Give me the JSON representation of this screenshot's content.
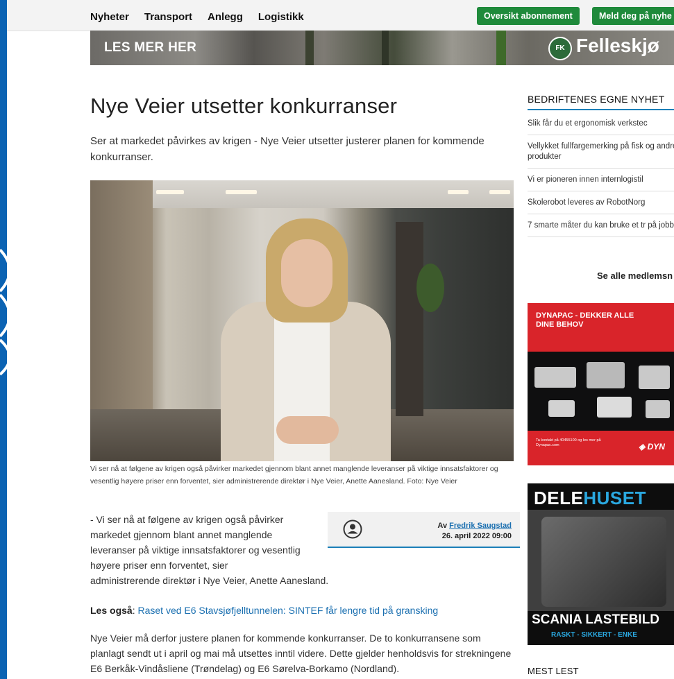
{
  "nav": {
    "items": [
      "Nyheter",
      "Transport",
      "Anlegg",
      "Logistikk"
    ],
    "subscription_button": "Oversikt abonnement",
    "newsletter_button": "Meld deg på nyhe"
  },
  "banner": {
    "text": "LES MER HER",
    "logo": "FK",
    "brand": "Felleskjø"
  },
  "article": {
    "title": "Nye Veier utsetter konkurranser",
    "lead": "Ser at markedet påvirkes av krigen - Nye Veier utsetter justerer planen for kommende konkurranser.",
    "caption": "Vi ser nå at følgene av krigen også påvirker markedet gjennom blant annet manglende leveranser på viktige innsatsfaktorer og vesentlig høyere priser enn forventet, sier administrerende direktør i Nye Veier, Anette Aanesland. Foto: Nye Veier",
    "body_quote": "- Vi ser nå at følgene av krigen også påvirker markedet gjennom blant annet manglende leveranser på viktige innsatsfaktorer og vesentlig høyere priser enn forventet, sier",
    "body_quote_end": "administrerende direktør i Nye Veier, Anette Aanesland.",
    "author_prefix": "Av",
    "author_name": "Fredrik Saugstad",
    "date": "26. april 2022 09:00",
    "les_ogsa_label": "Les også",
    "les_ogsa_link": "Raset ved E6 Stavsjøfjelltunnelen: SINTEF får lengre tid på gransking",
    "paragraph2": "Nye Veier må derfor justere planen for kommende konkurranser. De to konkurransene som planlagt sendt ut i april og mai må utsettes inntil videre. Dette gjelder henholdsvis for strekningene E6 Berkåk-Vindåsliene (Trøndelag) og E6 Sørelva-Borkamo (Nordland)."
  },
  "sidebar": {
    "heading": "BEDRIFTENES EGNE NYHET",
    "items": [
      "Slik får du et ergonomisk verkstec",
      "Vellykket fullfargemerking på fisk og andre produkter",
      "Vi er pioneren innen internlogistil",
      "Skolerobot leveres av RobotNorg",
      "7 smarte måter du kan bruke et tr på jobb"
    ],
    "see_all": "Se alle medlemsn",
    "ad1": {
      "title_line1": "DYNAPAC - DEKKER ALLE",
      "title_line2": "DINE BEHOV",
      "small": "Ta kontakt på 40455100 og les mer på Dynapac.com",
      "brand": "◈ DYN"
    },
    "ad2": {
      "logo_a": "DELE",
      "logo_b": "HUSET",
      "line1": "SCANIA LASTEBILD",
      "line2": "RASKT - SIKKERT - ENKE"
    },
    "mest_lest": "MEST LEST"
  },
  "colors": {
    "frame_blue": "#0b63b3",
    "nav_green": "#1f8a3b",
    "link_blue": "#1a6fb0",
    "accent_blue": "#1a7fb8",
    "ad_red": "#d9242a"
  }
}
